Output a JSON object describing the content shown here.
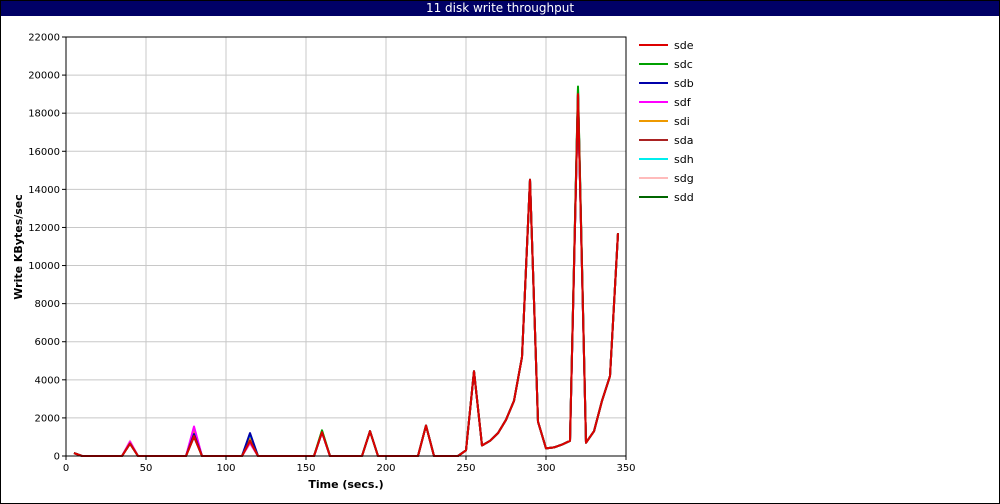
{
  "chart_data": {
    "type": "line",
    "title": "11 disk write throughput",
    "xlabel": "Time (secs.)",
    "ylabel": "Write KBytes/sec",
    "xlim": [
      0,
      350
    ],
    "ylim": [
      0,
      22000
    ],
    "x_ticks": [
      0,
      50,
      100,
      150,
      200,
      250,
      300,
      350
    ],
    "y_ticks": [
      0,
      2000,
      4000,
      6000,
      8000,
      10000,
      12000,
      14000,
      16000,
      18000,
      20000,
      22000
    ],
    "grid": true,
    "legend_position": "right",
    "x": [
      5,
      10,
      15,
      20,
      25,
      30,
      35,
      40,
      45,
      50,
      55,
      60,
      65,
      70,
      75,
      80,
      85,
      90,
      95,
      100,
      105,
      110,
      115,
      120,
      125,
      130,
      135,
      140,
      145,
      150,
      155,
      160,
      165,
      170,
      175,
      180,
      185,
      190,
      195,
      200,
      205,
      210,
      215,
      220,
      225,
      230,
      235,
      240,
      245,
      250,
      255,
      260,
      265,
      270,
      275,
      280,
      285,
      290,
      295,
      300,
      305,
      310,
      315,
      320,
      325,
      330,
      335,
      340,
      345
    ],
    "series": [
      {
        "name": "sde",
        "color": "#dd0000",
        "values": [
          150,
          0,
          0,
          0,
          0,
          0,
          0,
          650,
          0,
          0,
          0,
          0,
          0,
          0,
          0,
          1050,
          0,
          0,
          0,
          0,
          0,
          0,
          800,
          0,
          0,
          0,
          0,
          0,
          0,
          0,
          0,
          1250,
          0,
          0,
          0,
          0,
          0,
          1300,
          0,
          0,
          0,
          0,
          0,
          0,
          1600,
          0,
          0,
          0,
          0,
          300,
          4450,
          550,
          800,
          1200,
          1900,
          2900,
          5200,
          14500,
          1800,
          400,
          450,
          600,
          800,
          19000,
          700,
          1300,
          2900,
          4200,
          11700
        ]
      },
      {
        "name": "sdc",
        "color": "#00a000",
        "values": [
          150,
          0,
          0,
          0,
          0,
          0,
          0,
          650,
          0,
          0,
          0,
          0,
          0,
          0,
          0,
          1050,
          0,
          0,
          0,
          0,
          0,
          0,
          800,
          0,
          0,
          0,
          0,
          0,
          0,
          0,
          0,
          1350,
          0,
          0,
          0,
          0,
          0,
          1300,
          0,
          0,
          0,
          0,
          0,
          0,
          1600,
          0,
          0,
          0,
          0,
          300,
          4450,
          550,
          800,
          1200,
          1900,
          2900,
          5200,
          14500,
          1800,
          400,
          450,
          600,
          800,
          19400,
          700,
          1300,
          2900,
          4200,
          11700
        ]
      },
      {
        "name": "sdb",
        "color": "#0000aa",
        "values": [
          150,
          0,
          0,
          0,
          0,
          0,
          0,
          650,
          0,
          0,
          0,
          0,
          0,
          0,
          0,
          1150,
          0,
          0,
          0,
          0,
          0,
          0,
          1200,
          0,
          0,
          0,
          0,
          0,
          0,
          0,
          0,
          1250,
          0,
          0,
          0,
          0,
          0,
          1300,
          0,
          0,
          0,
          0,
          0,
          0,
          1600,
          0,
          0,
          0,
          0,
          300,
          4450,
          550,
          800,
          1200,
          1900,
          2900,
          5200,
          14500,
          1800,
          400,
          450,
          600,
          800,
          19000,
          700,
          1300,
          2900,
          4200,
          11700
        ]
      },
      {
        "name": "sdf",
        "color": "#ff00ff",
        "values": [
          150,
          0,
          0,
          0,
          0,
          0,
          0,
          750,
          0,
          0,
          0,
          0,
          0,
          0,
          0,
          1550,
          0,
          0,
          0,
          0,
          0,
          0,
          700,
          0,
          0,
          0,
          0,
          0,
          0,
          0,
          0,
          1250,
          0,
          0,
          0,
          0,
          0,
          1300,
          0,
          0,
          0,
          0,
          0,
          0,
          1600,
          0,
          0,
          0,
          0,
          300,
          4450,
          550,
          800,
          1200,
          1900,
          2900,
          5200,
          14500,
          1800,
          400,
          450,
          600,
          800,
          19000,
          700,
          1300,
          2900,
          4200,
          11700
        ]
      },
      {
        "name": "sdi",
        "color": "#ee9900",
        "values": [
          150,
          0,
          0,
          0,
          0,
          0,
          0,
          700,
          0,
          0,
          0,
          0,
          0,
          0,
          0,
          1300,
          0,
          0,
          0,
          0,
          0,
          0,
          900,
          0,
          0,
          0,
          0,
          0,
          0,
          0,
          0,
          1250,
          0,
          0,
          0,
          0,
          0,
          1300,
          0,
          0,
          0,
          0,
          0,
          0,
          1600,
          0,
          0,
          0,
          0,
          300,
          4450,
          550,
          800,
          1200,
          1900,
          2900,
          5200,
          14500,
          1800,
          400,
          450,
          600,
          800,
          19000,
          700,
          1300,
          2900,
          4200,
          11700
        ]
      },
      {
        "name": "sda",
        "color": "#aa2222",
        "values": [
          150,
          0,
          0,
          0,
          0,
          0,
          0,
          650,
          0,
          0,
          0,
          0,
          0,
          0,
          0,
          1000,
          0,
          0,
          0,
          0,
          0,
          0,
          750,
          0,
          0,
          0,
          0,
          0,
          0,
          0,
          0,
          1250,
          0,
          0,
          0,
          0,
          0,
          1300,
          0,
          0,
          0,
          0,
          0,
          0,
          1600,
          0,
          0,
          0,
          0,
          300,
          4450,
          550,
          800,
          1200,
          1900,
          2900,
          5200,
          14500,
          1800,
          400,
          450,
          600,
          800,
          19000,
          700,
          1300,
          2900,
          4200,
          11700
        ]
      },
      {
        "name": "sdh",
        "color": "#00eeee",
        "values": [
          150,
          0,
          0,
          0,
          0,
          0,
          0,
          700,
          0,
          0,
          0,
          0,
          0,
          0,
          0,
          1250,
          0,
          0,
          0,
          0,
          0,
          0,
          1000,
          0,
          0,
          0,
          0,
          0,
          0,
          0,
          0,
          1250,
          0,
          0,
          0,
          0,
          0,
          1300,
          0,
          0,
          0,
          0,
          0,
          0,
          1600,
          0,
          0,
          0,
          0,
          300,
          4450,
          550,
          800,
          1200,
          1900,
          2900,
          5200,
          14500,
          1800,
          400,
          450,
          600,
          800,
          19000,
          700,
          1300,
          2900,
          4200,
          11700
        ]
      },
      {
        "name": "sdg",
        "color": "#ffbbbb",
        "values": [
          150,
          0,
          0,
          0,
          0,
          0,
          0,
          800,
          0,
          0,
          0,
          0,
          0,
          0,
          0,
          1400,
          0,
          0,
          0,
          0,
          0,
          0,
          650,
          0,
          0,
          0,
          0,
          0,
          0,
          0,
          0,
          1250,
          0,
          0,
          0,
          0,
          0,
          1300,
          0,
          0,
          0,
          0,
          0,
          0,
          1600,
          0,
          0,
          0,
          0,
          300,
          4450,
          550,
          800,
          1200,
          1900,
          2900,
          5200,
          14500,
          1800,
          400,
          450,
          600,
          800,
          19000,
          700,
          1300,
          2900,
          4200,
          11700
        ]
      },
      {
        "name": "sdd",
        "color": "#006600",
        "values": [
          150,
          0,
          0,
          0,
          0,
          0,
          0,
          650,
          0,
          0,
          0,
          0,
          0,
          0,
          0,
          1100,
          0,
          0,
          0,
          0,
          0,
          0,
          1100,
          0,
          0,
          0,
          0,
          0,
          0,
          0,
          0,
          1300,
          0,
          0,
          0,
          0,
          0,
          1300,
          0,
          0,
          0,
          0,
          0,
          0,
          1600,
          0,
          0,
          0,
          0,
          300,
          4450,
          550,
          800,
          1200,
          1900,
          2900,
          5200,
          14500,
          1800,
          400,
          450,
          600,
          800,
          19300,
          700,
          1300,
          2900,
          4200,
          11700
        ]
      }
    ]
  }
}
